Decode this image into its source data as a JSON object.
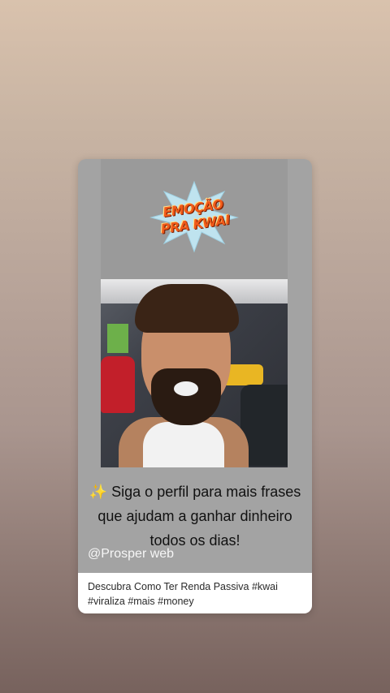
{
  "sticker": {
    "line1": "EMOÇÃO",
    "line2": "PRA KWAI"
  },
  "caption": {
    "emoji": "✨",
    "line1": "Siga o perfil para mais frases",
    "line2": "que ajudam a ganhar dinheiro",
    "line3": "todos os dias!"
  },
  "handle": "@Prosper web",
  "description": {
    "line1": "Descubra Como Ter Renda Passiva #kwai",
    "line2": "#viraliza #mais #money"
  },
  "colors": {
    "sticker_text": "#f05a1a",
    "sticker_star": "#bfe3ef",
    "card_bg": "#a3a3a3"
  }
}
